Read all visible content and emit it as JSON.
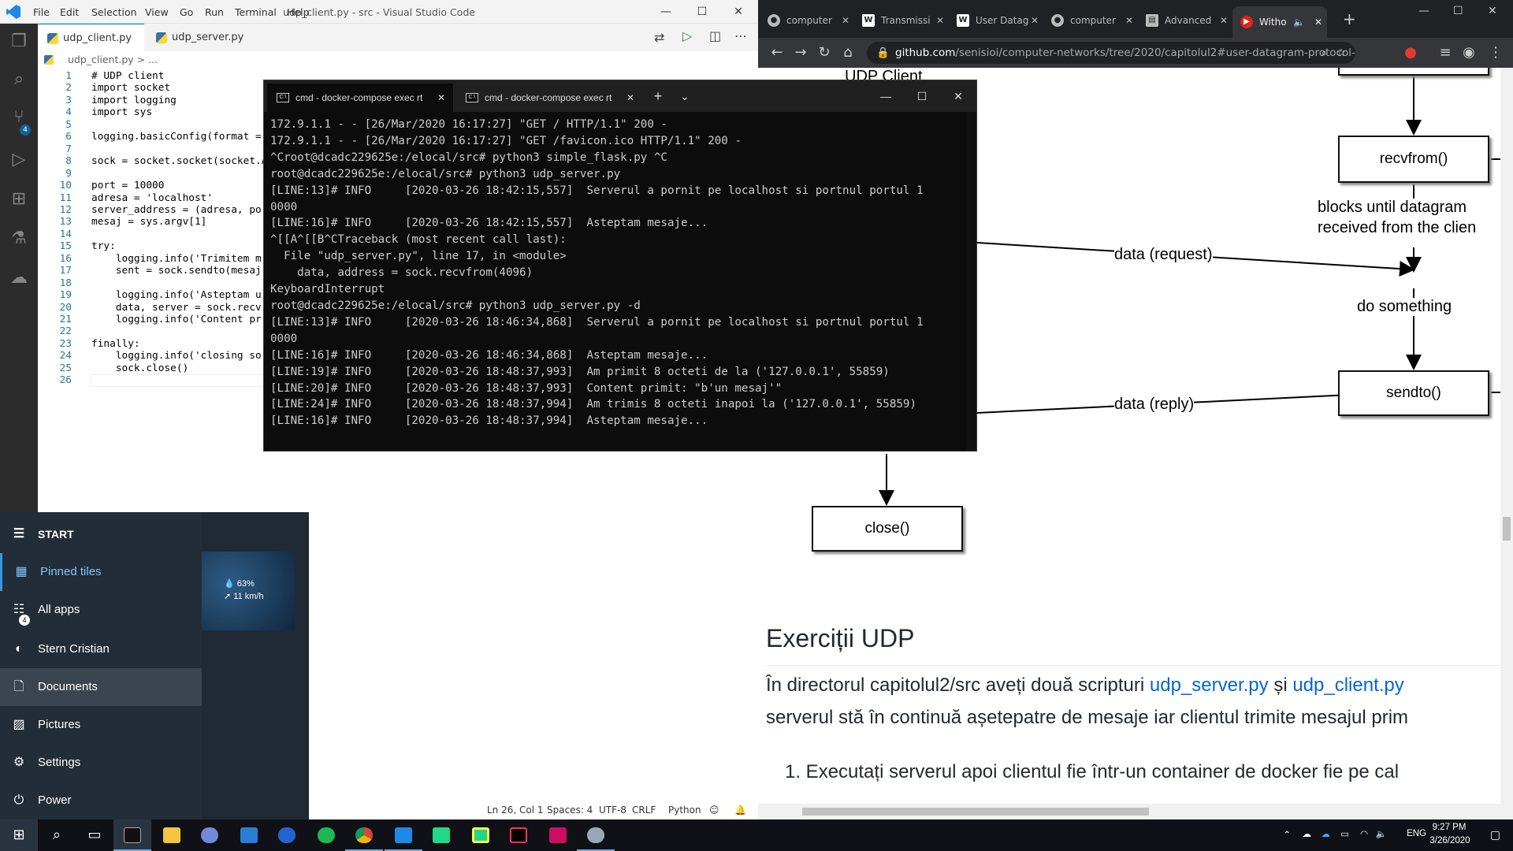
{
  "vscode": {
    "menu": [
      "File",
      "Edit",
      "Selection",
      "View",
      "Go",
      "Run",
      "Terminal",
      "Help"
    ],
    "window_title": "udp_client.py - src - Visual Studio Code",
    "tabs": [
      {
        "label": "udp_client.py"
      },
      {
        "label": "udp_server.py"
      }
    ],
    "breadcrumb": "udp_client.py > ...",
    "scm_badge": "4",
    "lines": [
      {
        "n": "1",
        "code": "# UDP client"
      },
      {
        "n": "2",
        "code": "import socket"
      },
      {
        "n": "3",
        "code": "import logging"
      },
      {
        "n": "4",
        "code": "import sys"
      },
      {
        "n": "5",
        "code": ""
      },
      {
        "n": "6",
        "code": "logging.basicConfig(format = "
      },
      {
        "n": "7",
        "code": ""
      },
      {
        "n": "8",
        "code": "sock = socket.socket(socket.A"
      },
      {
        "n": "9",
        "code": ""
      },
      {
        "n": "10",
        "code": "port = 10000"
      },
      {
        "n": "11",
        "code": "adresa = 'localhost'"
      },
      {
        "n": "12",
        "code": "server_address = (adresa, po"
      },
      {
        "n": "13",
        "code": "mesaj = sys.argv[1]"
      },
      {
        "n": "14",
        "code": ""
      },
      {
        "n": "15",
        "code": "try:"
      },
      {
        "n": "16",
        "code": "    logging.info('Trimitem m"
      },
      {
        "n": "17",
        "code": "    sent = sock.sendto(mesaj"
      },
      {
        "n": "18",
        "code": ""
      },
      {
        "n": "19",
        "code": "    logging.info('Asteptam u"
      },
      {
        "n": "20",
        "code": "    data, server = sock.recv"
      },
      {
        "n": "21",
        "code": "    logging.info('Content pr"
      },
      {
        "n": "22",
        "code": ""
      },
      {
        "n": "23",
        "code": "finally:"
      },
      {
        "n": "24",
        "code": "    logging.info('closing so"
      },
      {
        "n": "25",
        "code": "    sock.close()"
      },
      {
        "n": "26",
        "code": ""
      }
    ],
    "status": {
      "position": "Ln 26, Col 1",
      "spaces": "Spaces: 4",
      "encoding": "UTF-8",
      "eol": "CRLF",
      "language": "Python"
    }
  },
  "terminal": {
    "tabs": [
      {
        "label": "cmd - docker-compose  exec rt"
      },
      {
        "label": "cmd - docker-compose  exec rt"
      }
    ],
    "lines": [
      "172.9.1.1 - - [26/Mar/2020 16:17:27] \"GET / HTTP/1.1\" 200 -",
      "172.9.1.1 - - [26/Mar/2020 16:17:27] \"GET /favicon.ico HTTP/1.1\" 200 -",
      "^Croot@dcadc229625e:/elocal/src# python3 simple_flask.py ^C",
      "root@dcadc229625e:/elocal/src# python3 udp_server.py",
      "[LINE:13]# INFO     [2020-03-26 18:42:15,557]  Serverul a pornit pe localhost si portnul portul 1",
      "0000",
      "[LINE:16]# INFO     [2020-03-26 18:42:15,557]  Asteptam mesaje...",
      "^[[A^[[B^CTraceback (most recent call last):",
      "  File \"udp_server.py\", line 17, in <module>",
      "    data, address = sock.recvfrom(4096)",
      "KeyboardInterrupt",
      "root@dcadc229625e:/elocal/src# python3 udp_server.py -d",
      "[LINE:13]# INFO     [2020-03-26 18:46:34,868]  Serverul a pornit pe localhost si portnul portul 1",
      "0000",
      "[LINE:16]# INFO     [2020-03-26 18:46:34,868]  Asteptam mesaje...",
      "[LINE:19]# INFO     [2020-03-26 18:48:37,993]  Am primit 8 octeti de la ('127.0.0.1', 55859)",
      "[LINE:20]# INFO     [2020-03-26 18:48:37,993]  Content primit: \"b'un mesaj'\"",
      "[LINE:24]# INFO     [2020-03-26 18:48:37,994]  Am trimis 8 octeti inapoi la ('127.0.0.1', 55859)",
      "[LINE:16]# INFO     [2020-03-26 18:48:37,994]  Asteptam mesaje..."
    ]
  },
  "browser": {
    "tabs": [
      {
        "label": "computer",
        "icon": "github"
      },
      {
        "label": "Transmissi",
        "icon": "W"
      },
      {
        "label": "User Datag",
        "icon": "W"
      },
      {
        "label": "computer",
        "icon": "github"
      },
      {
        "label": "Advanced",
        "icon": "doc"
      },
      {
        "label": "Witho",
        "icon": "youtube"
      }
    ],
    "url_host": "github.com",
    "url_path": "/senisioi/computer-networks/tree/2020/capitolul2#user-datagram-protocol--...",
    "diagram": {
      "udp_client_label": "UDP Client",
      "recvfrom": "recvfrom()",
      "blocks_line1": "blocks until datagram",
      "blocks_line2": "received from the clien",
      "data_request": "data (request)",
      "do_something": "do something",
      "sendto": "sendto()",
      "data_reply": "data (reply)",
      "close": "close()"
    },
    "heading": "Exerciții UDP",
    "para_prefix": "În directorul capitolul2/src aveți două scripturi ",
    "link1": "udp_server.py",
    "para_mid": " și ",
    "link2": "udp_client.py",
    "para_line2": "serverul stă în continuă așetepatre de mesaje iar clientul trimite mesajul prim",
    "list_item1": "1. Executați serverul apoi clientul fie într-un container de docker fie pe cal"
  },
  "start_menu": {
    "title": "START",
    "items": [
      "Pinned tiles",
      "All apps",
      "Stern Cristian",
      "Documents",
      "Pictures",
      "Settings",
      "Power"
    ],
    "all_apps_badge": "4",
    "weather_humidity": "63%",
    "weather_wind": "11 km/h"
  },
  "taskbar": {
    "lang": "ENG",
    "time": "9:27 PM",
    "date": "3/26/2020"
  },
  "colors": {
    "vscode_accent": "#007acc",
    "link": "#0366d6",
    "terminal_bg": "#0c0c0c",
    "taskbar_bg": "#0f1116"
  }
}
